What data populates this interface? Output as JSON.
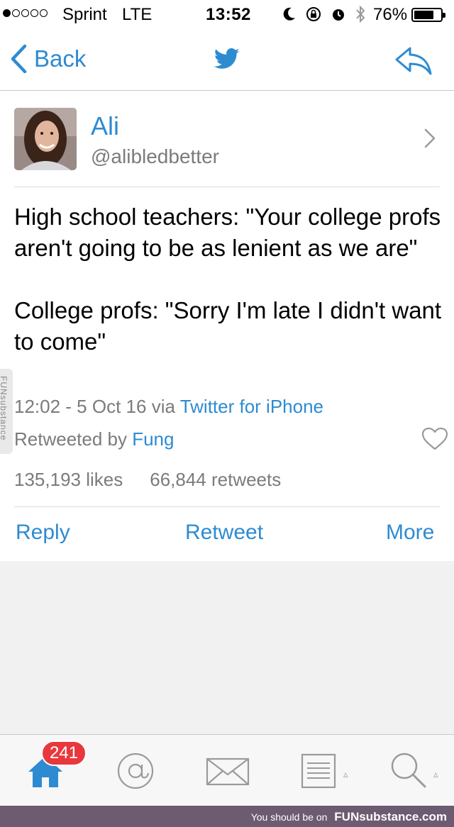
{
  "status_bar": {
    "carrier": "Sprint",
    "network": "LTE",
    "time": "13:52",
    "battery_percent": "76%",
    "battery_level": 0.76,
    "signal_bars_filled": 1,
    "signal_bars_total": 5
  },
  "nav": {
    "back_label": "Back",
    "accent_color": "#2d8bd2"
  },
  "tweet": {
    "author_name": "Ali",
    "author_handle": "@alibledbetter",
    "text": "High school teachers: \"Your college profs aren't going to be as lenient as we are\"\n\nCollege profs: \"Sorry I'm late I didn't want to come\"",
    "timestamp": "12:02 - 5 Oct 16",
    "via_label": "via",
    "source": "Twitter for iPhone",
    "retweeted_by_label": "Retweeted by",
    "retweeted_by": "Fung",
    "likes": "135,193 likes",
    "retweets": "66,844 retweets"
  },
  "actions": {
    "reply": "Reply",
    "retweet": "Retweet",
    "more": "More"
  },
  "tab_bar": {
    "home_badge": "241",
    "icons": [
      "home-icon",
      "mentions-icon",
      "messages-icon",
      "lists-icon",
      "search-icon"
    ]
  },
  "watermark": {
    "side_text": "FUNsubstance",
    "footer_text": "You should be on",
    "footer_brand": "FUNsubstance.com"
  }
}
